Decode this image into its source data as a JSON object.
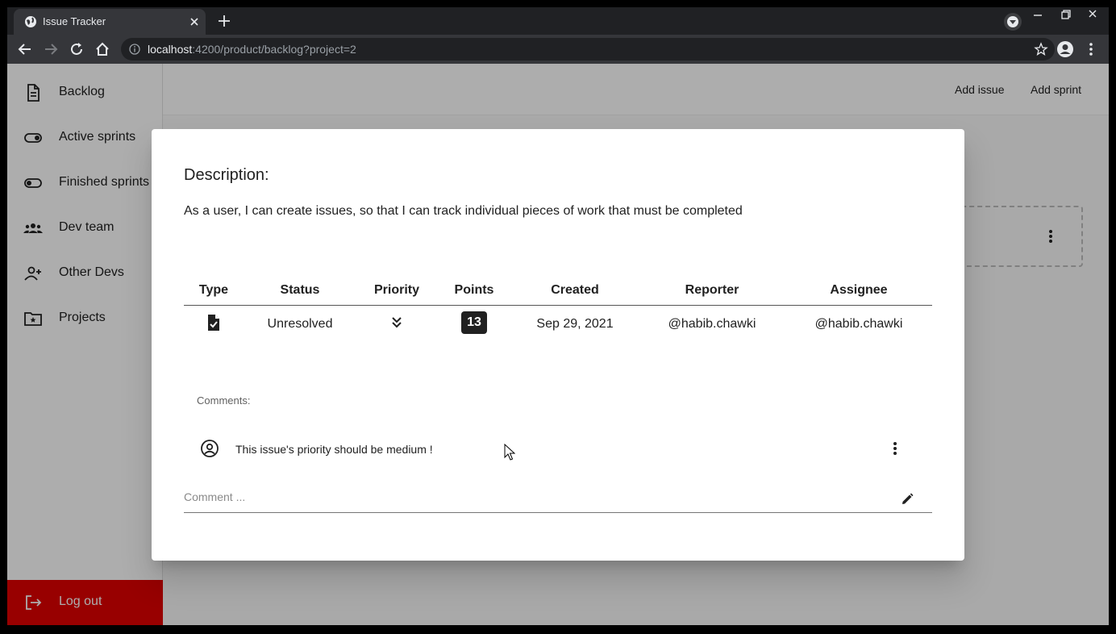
{
  "browser": {
    "tab_title": "Issue Tracker",
    "url_host": "localhost",
    "url_rest": ":4200/product/backlog?project=2"
  },
  "sidebar": {
    "items": [
      {
        "label": "Backlog",
        "icon": "document-icon"
      },
      {
        "label": "Active sprints",
        "icon": "toggle-on-icon"
      },
      {
        "label": "Finished sprints",
        "icon": "toggle-off-icon"
      },
      {
        "label": "Dev team",
        "icon": "group-icon"
      },
      {
        "label": "Other Devs",
        "icon": "person-add-icon"
      },
      {
        "label": "Projects",
        "icon": "folder-star-icon"
      }
    ],
    "logout_label": "Log out"
  },
  "header": {
    "add_issue_label": "Add issue",
    "add_sprint_label": "Add sprint"
  },
  "dialog": {
    "title": "Description:",
    "description": "As a user, I can create issues, so that I can track individual pieces of work that must be completed",
    "table": {
      "headers": {
        "type": "Type",
        "status": "Status",
        "priority": "Priority",
        "points": "Points",
        "created": "Created",
        "reporter": "Reporter",
        "assignee": "Assignee"
      },
      "row": {
        "type_icon": "task-document-icon",
        "status": "Unresolved",
        "priority_icon": "double-chevron-down-icon",
        "points": "13",
        "created": "Sep 29, 2021",
        "reporter": "@habib.chawki",
        "assignee": "@habib.chawki"
      }
    },
    "comments_label": "Comments:",
    "comments": [
      {
        "text": "This issue's priority should be medium !",
        "avatar_icon": "account-circle-icon"
      }
    ],
    "comment_placeholder": "Comment ..."
  },
  "colors": {
    "logout_bg": "#e00000",
    "badge_bg": "#212121",
    "chrome_bg": "#202124",
    "chrome_toolbar": "#35363a"
  }
}
